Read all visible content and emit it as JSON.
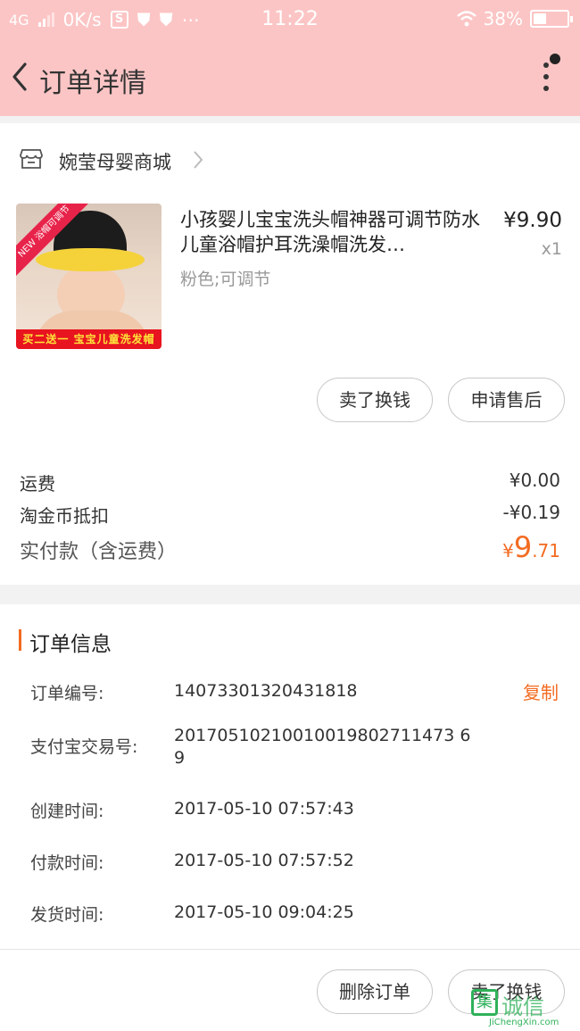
{
  "status_bar": {
    "network": "4G",
    "speed": "0K/s",
    "s_icon_label": "S",
    "time": "11:22",
    "battery": "38%",
    "battery_level": 0.38
  },
  "nav": {
    "title": "订单详情"
  },
  "shop": {
    "name": "婉莹母婴商城"
  },
  "product": {
    "title": "小孩婴儿宝宝洗头帽神器可调节防水儿童浴帽护耳洗澡帽洗发…",
    "spec": "粉色;可调节",
    "price": "¥9.90",
    "qty": "x1",
    "thumb_badge": "浴帽可调节",
    "thumb_new": "NEW",
    "thumb_banner": "买二送一 宝宝儿童洗发帽"
  },
  "item_actions": {
    "sell_label": "卖了换钱",
    "aftersale_label": "申请售后"
  },
  "fees": [
    {
      "label": "运费",
      "value": "¥0.00"
    },
    {
      "label": "淘金币抵扣",
      "value": "-¥0.19"
    }
  ],
  "total": {
    "label": "实付款（含运费）",
    "currency": "¥",
    "integer": "9",
    "decimal": ".71"
  },
  "order_info": {
    "section_title": "订单信息",
    "copy_label": "复制",
    "rows": [
      {
        "label": "订单编号:",
        "value": "14073301320431818"
      },
      {
        "label": "支付宝交易号:",
        "value": "20170510210010019802711473 69"
      },
      {
        "label": "创建时间:",
        "value": "2017-05-10 07:57:43"
      },
      {
        "label": "付款时间:",
        "value": "2017-05-10 07:57:52"
      },
      {
        "label": "发货时间:",
        "value": "2017-05-10 09:04:25"
      }
    ]
  },
  "bottom_actions": {
    "delete_label": "删除订单",
    "sell_label": "卖了换钱"
  },
  "watermark": {
    "char": "集",
    "text": "诚信",
    "url": "JiChengXin.com"
  },
  "colors": {
    "header_bg": "#fcc5c5",
    "accent": "#f36b21"
  }
}
